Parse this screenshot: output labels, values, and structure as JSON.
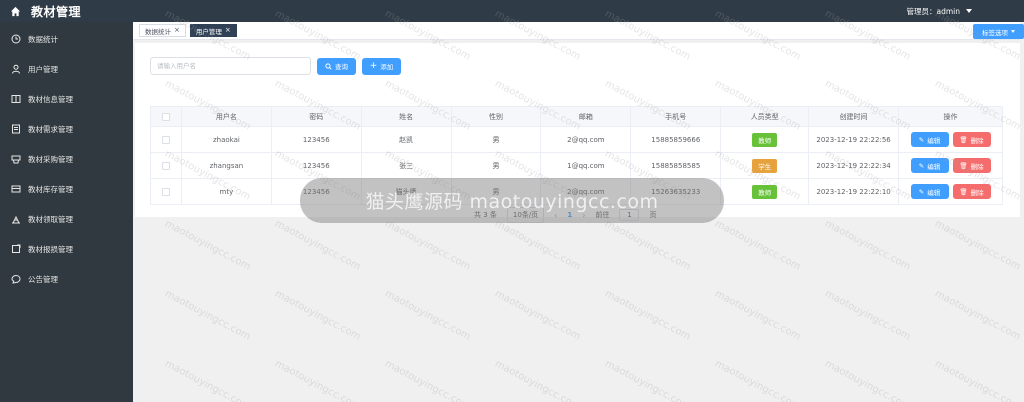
{
  "header": {
    "title": "教材管理",
    "admin_label": "管理员：admin"
  },
  "sidebar": {
    "items": [
      {
        "label": "数据统计",
        "icon": "clock-icon"
      },
      {
        "label": "用户管理",
        "icon": "user-icon"
      },
      {
        "label": "教材信息管理",
        "icon": "book-icon"
      },
      {
        "label": "教材需求管理",
        "icon": "document-icon"
      },
      {
        "label": "教材采购管理",
        "icon": "purchase-icon"
      },
      {
        "label": "教材库存管理",
        "icon": "inventory-icon"
      },
      {
        "label": "教材领取管理",
        "icon": "receive-icon"
      },
      {
        "label": "教材报损管理",
        "icon": "report-icon"
      },
      {
        "label": "公告管理",
        "icon": "chat-icon"
      }
    ]
  },
  "tabs": {
    "items": [
      {
        "label": "数据统计",
        "active": false
      },
      {
        "label": "用户管理",
        "active": true
      }
    ],
    "options_label": "标签选项"
  },
  "toolbar": {
    "search_placeholder": "请输入用户名",
    "search_label": "查询",
    "add_label": "添加"
  },
  "table": {
    "headers": [
      "用户名",
      "密码",
      "姓名",
      "性别",
      "邮箱",
      "手机号",
      "人员类型",
      "创建时间",
      "操作"
    ],
    "rows": [
      {
        "username": "zhaokai",
        "password": "123456",
        "name": "赵凯",
        "gender": "男",
        "email": "2@qq.com",
        "phone": "15885859666",
        "type": "教师",
        "created": "2023-12-19 22:22:56"
      },
      {
        "username": "zhangsan",
        "password": "123456",
        "name": "张三",
        "gender": "男",
        "email": "1@qq.com",
        "phone": "15885858585",
        "type": "学生",
        "created": "2023-12-19 22:22:34"
      },
      {
        "username": "mty",
        "password": "123456",
        "name": "猫头鹰",
        "gender": "男",
        "email": "2@qq.com",
        "phone": "15263635233",
        "type": "教师",
        "created": "2023-12-19 22:22:10"
      }
    ],
    "edit_label": "编辑",
    "delete_label": "删除"
  },
  "pagination": {
    "total_label": "共 3 条",
    "page_size_label": "10条/页",
    "current_page": "1",
    "goto_label": "前往",
    "goto_value": "1",
    "page_suffix": "页"
  },
  "overlay": {
    "text": "猫头鹰源码 maotouyingcc.com"
  },
  "colors": {
    "teacher": "#67c23a",
    "student": "#e6a23c",
    "primary": "#409eff",
    "danger": "#f56c6c",
    "sidebar": "#30393f"
  }
}
